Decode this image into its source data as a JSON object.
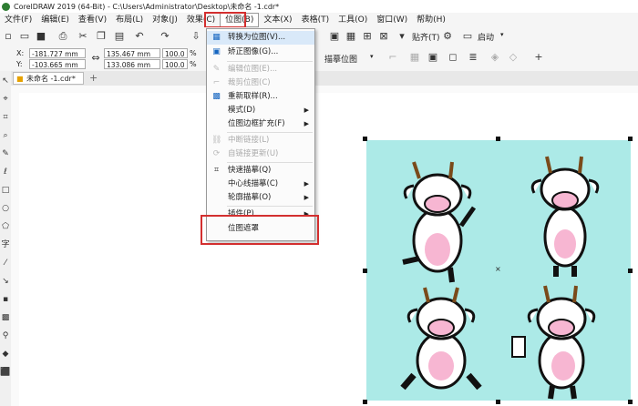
{
  "window": {
    "title": "CorelDRAW 2019 (64-Bit) - C:\\Users\\Administrator\\Desktop\\未命名 -1.cdr*"
  },
  "menubar": [
    {
      "label": "文件(F)"
    },
    {
      "label": "编辑(E)"
    },
    {
      "label": "查看(V)"
    },
    {
      "label": "布局(L)"
    },
    {
      "label": "对象(J)"
    },
    {
      "label": "效果(C)"
    },
    {
      "label": "位图(B)"
    },
    {
      "label": "文本(X)"
    },
    {
      "label": "表格(T)"
    },
    {
      "label": "工具(O)"
    },
    {
      "label": "窗口(W)"
    },
    {
      "label": "帮助(H)"
    }
  ],
  "toolbar1": {
    "snap_label": "贴齐(T)",
    "launch_label": "启动"
  },
  "propbar": {
    "x_label": "X:",
    "y_label": "Y:",
    "x_value": "-181.727 mm",
    "y_value": "-103.665 mm",
    "w_value": "135.467 mm",
    "h_value": "133.086 mm",
    "scale_w": "100.0",
    "scale_h": "100.0",
    "pct": "%",
    "trace_label": "描摹位图"
  },
  "document": {
    "tab_label": "未命名 -1.cdr*"
  },
  "bitmap_menu": {
    "items": [
      {
        "label": "转换为位图(V)...",
        "icon": "convert-bitmap-icon",
        "disabled": false,
        "arrow": false
      },
      {
        "label": "矫正图像(G)...",
        "icon": "straighten-image-icon",
        "disabled": false,
        "arrow": false
      },
      {
        "label": "编辑位图(E)...",
        "icon": "edit-bitmap-icon",
        "disabled": true,
        "arrow": false
      },
      {
        "label": "裁剪位图(C)",
        "icon": "crop-bitmap-icon",
        "disabled": true,
        "arrow": false
      },
      {
        "label": "重新取样(R)...",
        "icon": "resample-icon",
        "disabled": false,
        "arrow": false
      },
      {
        "label": "模式(D)",
        "icon": "",
        "disabled": false,
        "arrow": true
      },
      {
        "label": "位图边框扩充(F)",
        "icon": "",
        "disabled": false,
        "arrow": true
      },
      {
        "label": "中断链接(L)",
        "icon": "break-link-icon",
        "disabled": true,
        "arrow": false
      },
      {
        "label": "自链接更新(U)",
        "icon": "update-link-icon",
        "disabled": true,
        "arrow": false
      },
      {
        "label": "快速描摹(Q)",
        "icon": "quick-trace-icon",
        "disabled": false,
        "arrow": false
      },
      {
        "label": "中心线描摹(C)",
        "icon": "",
        "disabled": false,
        "arrow": true
      },
      {
        "label": "轮廓描摹(O)",
        "icon": "",
        "disabled": false,
        "arrow": true
      },
      {
        "label": "插件(P)",
        "icon": "",
        "disabled": false,
        "arrow": true
      },
      {
        "label": "位图遮罩",
        "icon": "",
        "disabled": false,
        "arrow": false
      }
    ]
  },
  "colors": {
    "accent_red": "#d32f2f",
    "bitmap_bg": "#aceae7",
    "cow_pink": "#f7b6d2"
  }
}
